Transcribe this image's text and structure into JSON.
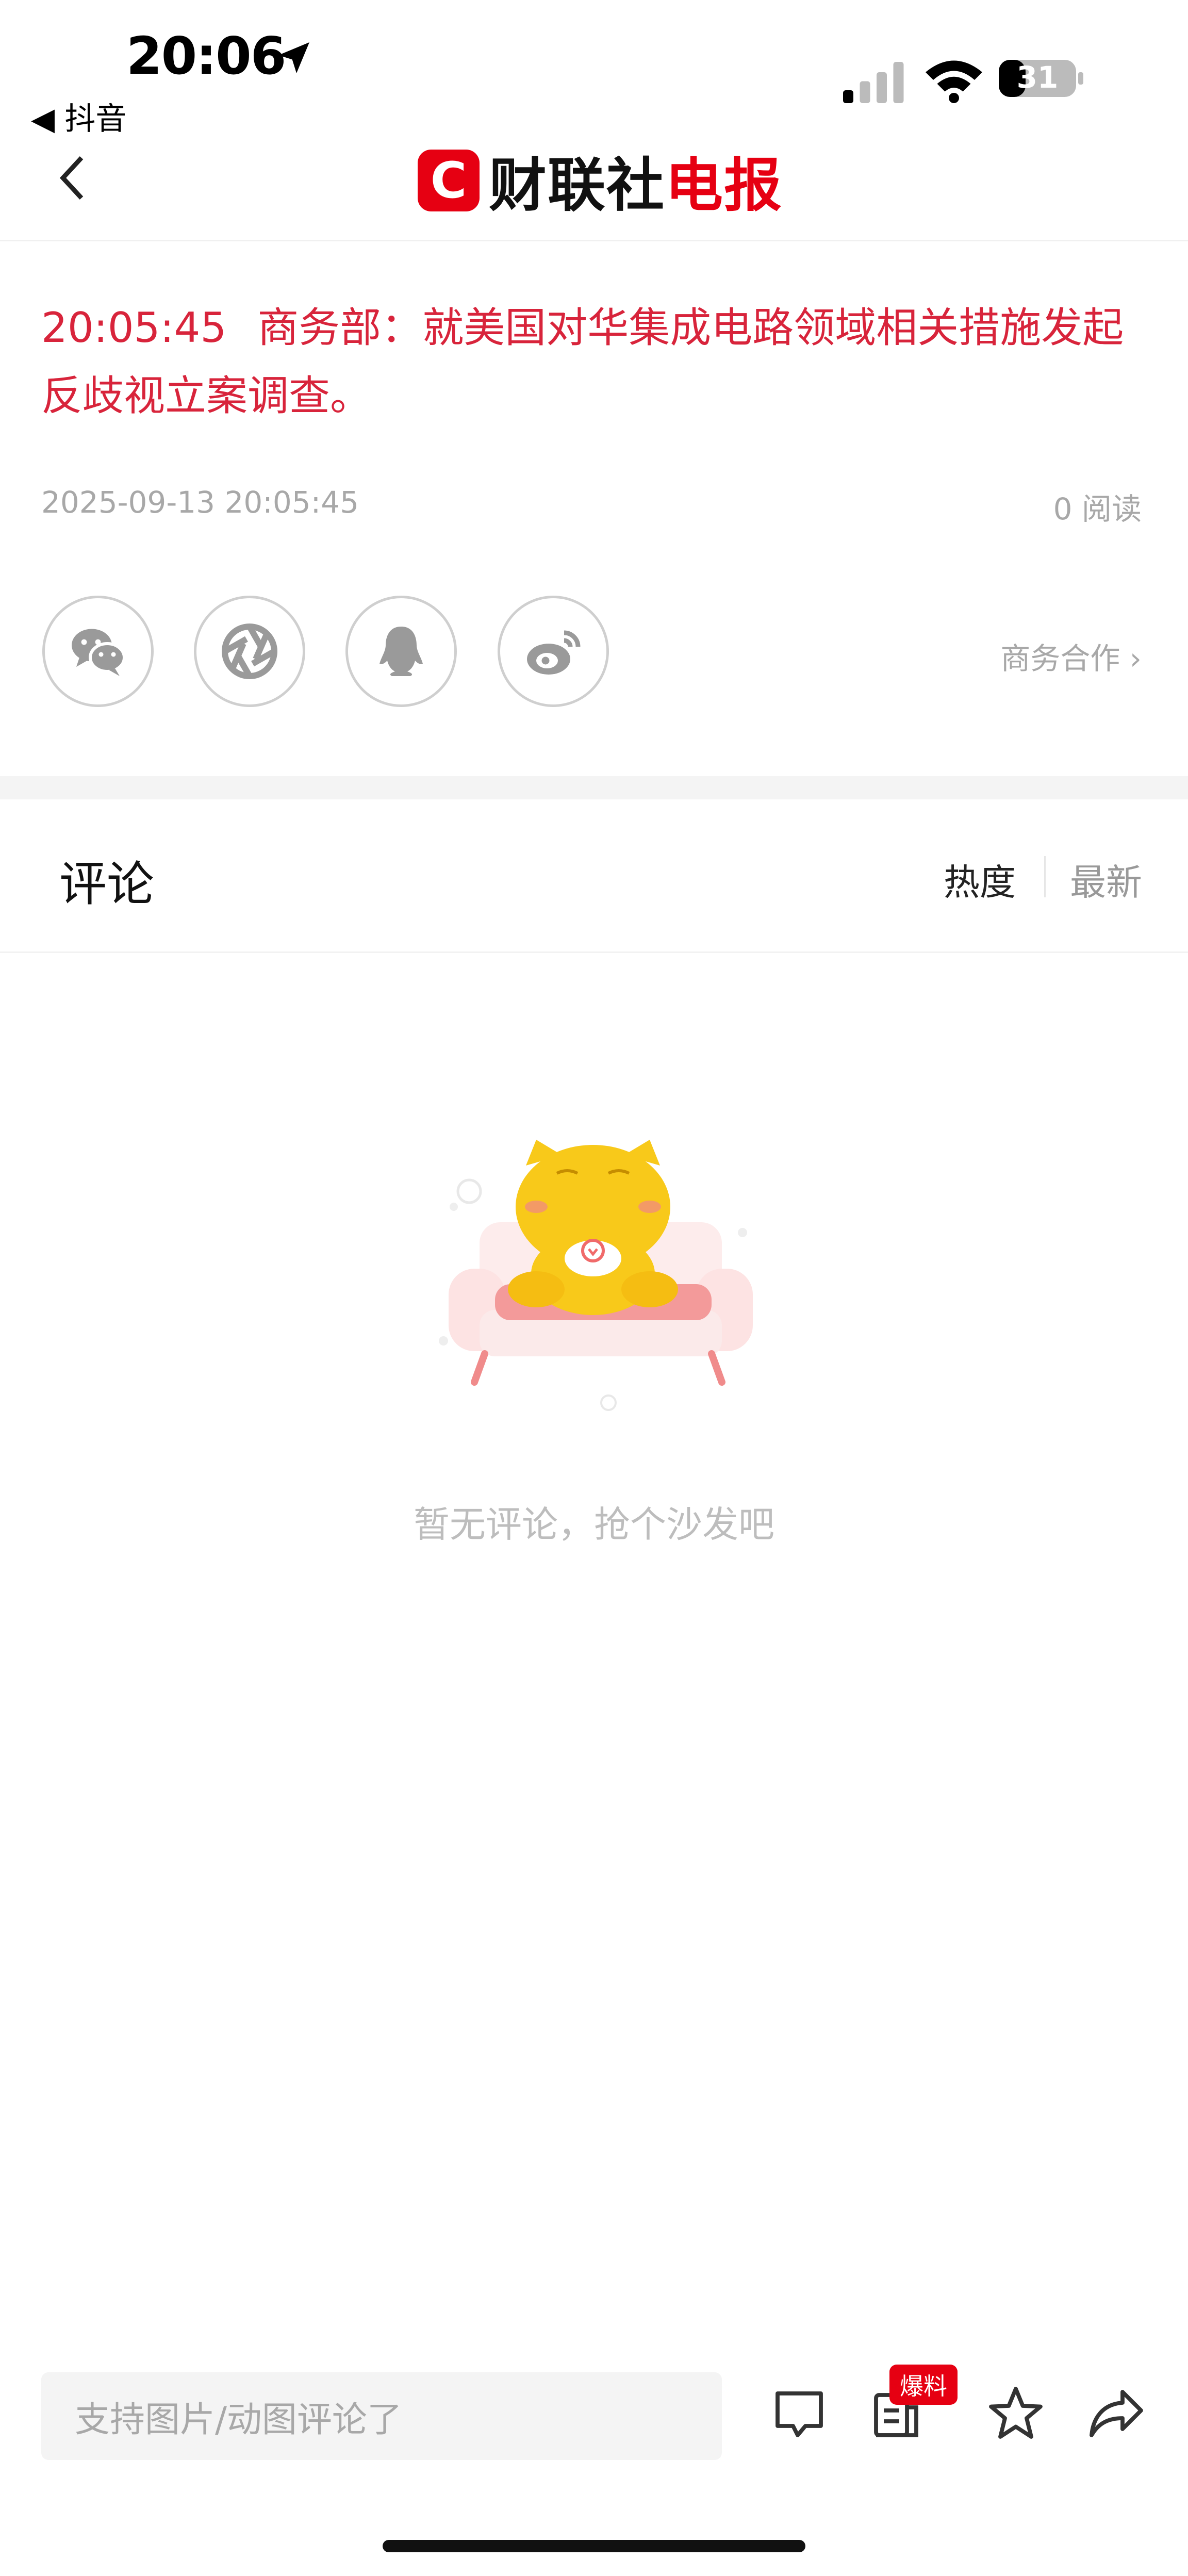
{
  "status_bar": {
    "time": "20:06",
    "back_app": "◀ 抖音",
    "battery": "31"
  },
  "nav": {
    "logo_letter": "C",
    "logo_black": "财联社",
    "logo_red": "电报",
    "brand_color": "#e60012"
  },
  "article": {
    "time": "20:05:45",
    "headline": "商务部：就美国对华集成电路领域相关措施发起反歧视立案调查。",
    "date": "2025-09-13 20:05:45",
    "read_count": "0 阅读",
    "headline_color": "#d8243b"
  },
  "share": {
    "icons": [
      "wechat-icon",
      "moments-icon",
      "qq-icon",
      "weibo-icon"
    ],
    "business_link": "商务合作 ›"
  },
  "comments": {
    "title": "评论",
    "sort_hot": "热度",
    "sort_new": "最新",
    "empty_text": "暂无评论，抢个沙发吧"
  },
  "bottom_bar": {
    "input_placeholder": "支持图片/动图评论了",
    "tip_badge": "爆料",
    "icons": [
      "comment-icon",
      "tip-icon",
      "star-icon",
      "share-icon"
    ]
  }
}
